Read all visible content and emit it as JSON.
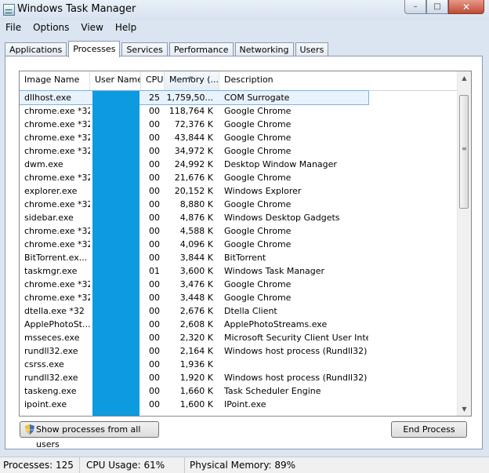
{
  "window": {
    "title": "Windows Task Manager",
    "min_label": "–",
    "max_label": "□",
    "close_label": "✕"
  },
  "menu": [
    "File",
    "Options",
    "View",
    "Help"
  ],
  "tabs": [
    "Applications",
    "Processes",
    "Services",
    "Performance",
    "Networking",
    "Users"
  ],
  "active_tab": "Processes",
  "table": {
    "columns": [
      "Image Name",
      "User Name",
      "CPU",
      "Memory (...",
      "Description"
    ],
    "sorted_column": "Memory (...",
    "rows": [
      {
        "name": "dllhost.exe",
        "user": "",
        "cpu": "25",
        "mem": "1,759,50...",
        "desc": "COM Surrogate"
      },
      {
        "name": "chrome.exe *32",
        "user": "",
        "cpu": "00",
        "mem": "118,764 K",
        "desc": "Google Chrome"
      },
      {
        "name": "chrome.exe *32",
        "user": "",
        "cpu": "00",
        "mem": "72,376 K",
        "desc": "Google Chrome"
      },
      {
        "name": "chrome.exe *32",
        "user": "",
        "cpu": "00",
        "mem": "43,844 K",
        "desc": "Google Chrome"
      },
      {
        "name": "chrome.exe *32",
        "user": "",
        "cpu": "00",
        "mem": "34,972 K",
        "desc": "Google Chrome"
      },
      {
        "name": "dwm.exe",
        "user": "",
        "cpu": "00",
        "mem": "24,992 K",
        "desc": "Desktop Window Manager"
      },
      {
        "name": "chrome.exe *32",
        "user": "",
        "cpu": "00",
        "mem": "21,676 K",
        "desc": "Google Chrome"
      },
      {
        "name": "explorer.exe",
        "user": "",
        "cpu": "00",
        "mem": "20,152 K",
        "desc": "Windows Explorer"
      },
      {
        "name": "chrome.exe *32",
        "user": "",
        "cpu": "00",
        "mem": "8,880 K",
        "desc": "Google Chrome"
      },
      {
        "name": "sidebar.exe",
        "user": "",
        "cpu": "00",
        "mem": "4,876 K",
        "desc": "Windows Desktop Gadgets"
      },
      {
        "name": "chrome.exe *32",
        "user": "",
        "cpu": "00",
        "mem": "4,588 K",
        "desc": "Google Chrome"
      },
      {
        "name": "chrome.exe *32",
        "user": "",
        "cpu": "00",
        "mem": "4,096 K",
        "desc": "Google Chrome"
      },
      {
        "name": "BitTorrent.ex...",
        "user": "",
        "cpu": "00",
        "mem": "3,844 K",
        "desc": "BitTorrent"
      },
      {
        "name": "taskmgr.exe",
        "user": "",
        "cpu": "01",
        "mem": "3,600 K",
        "desc": "Windows Task Manager"
      },
      {
        "name": "chrome.exe *32",
        "user": "",
        "cpu": "00",
        "mem": "3,476 K",
        "desc": "Google Chrome"
      },
      {
        "name": "chrome.exe *32",
        "user": "",
        "cpu": "00",
        "mem": "3,448 K",
        "desc": "Google Chrome"
      },
      {
        "name": "dtella.exe *32",
        "user": "",
        "cpu": "00",
        "mem": "2,676 K",
        "desc": "Dtella Client"
      },
      {
        "name": "ApplePhotoSt...",
        "user": "",
        "cpu": "00",
        "mem": "2,608 K",
        "desc": "ApplePhotoStreams.exe"
      },
      {
        "name": "msseces.exe",
        "user": "",
        "cpu": "00",
        "mem": "2,320 K",
        "desc": "Microsoft Security Client User Inte..."
      },
      {
        "name": "rundll32.exe",
        "user": "",
        "cpu": "00",
        "mem": "2,164 K",
        "desc": "Windows host process (Rundll32)"
      },
      {
        "name": "csrss.exe",
        "user": "",
        "cpu": "00",
        "mem": "1,936 K",
        "desc": ""
      },
      {
        "name": "rundll32.exe",
        "user": "",
        "cpu": "00",
        "mem": "1,920 K",
        "desc": "Windows host process (Rundll32)"
      },
      {
        "name": "taskeng.exe",
        "user": "",
        "cpu": "00",
        "mem": "1,660 K",
        "desc": "Task Scheduler Engine"
      },
      {
        "name": "ipoint.exe",
        "user": "",
        "cpu": "00",
        "mem": "1,600 K",
        "desc": "IPoint.exe"
      }
    ]
  },
  "buttons": {
    "show_all": "Show processes from all users",
    "end_process": "End Process"
  },
  "status": {
    "processes": "Processes: 125",
    "cpu": "CPU Usage: 61%",
    "memory": "Physical Memory: 89%"
  },
  "colors": {
    "redaction": "#0d9be0",
    "selection": "#e8f2fc"
  },
  "icons": {
    "app": "task-manager-icon",
    "shield": "uac-shield-icon"
  }
}
